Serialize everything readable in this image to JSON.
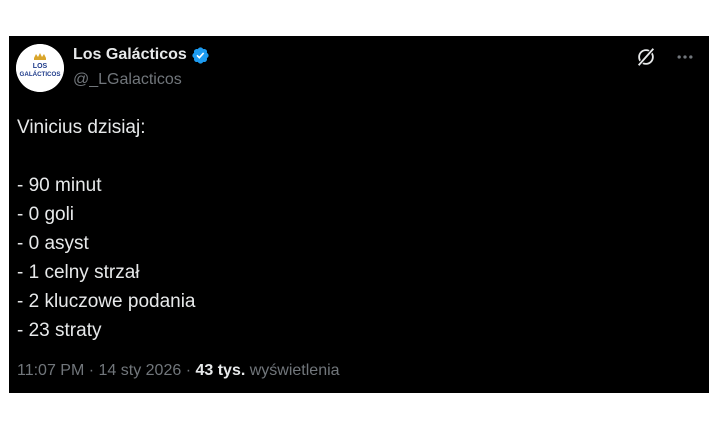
{
  "author": {
    "display_name": "Los Galácticos",
    "handle": "@_LGalacticos",
    "avatar_text_top": "LOS",
    "avatar_text_bottom": "GALÁCTICOS",
    "verified_color": "#1d9bf0"
  },
  "actions": {
    "grok_icon": "grok-icon",
    "more_icon": "more-icon"
  },
  "tweet": {
    "lines": [
      "Vinicius dzisiaj:",
      "",
      "- 90 minut",
      "- 0 goli",
      "- 0 asyst",
      "- 1 celny strzał",
      "- 2 kluczowe podania",
      "- 23 straty"
    ]
  },
  "meta": {
    "time": "11:07 PM",
    "separator": " · ",
    "date": "14 sty 2026",
    "views_count": "43 tys.",
    "views_label": " wyświetlenia"
  },
  "colors": {
    "background": "#000000",
    "text": "#e7e9ea",
    "secondary": "#71767b",
    "brand_blue": "#1d3a8a",
    "brand_gold": "#d9a52b"
  }
}
